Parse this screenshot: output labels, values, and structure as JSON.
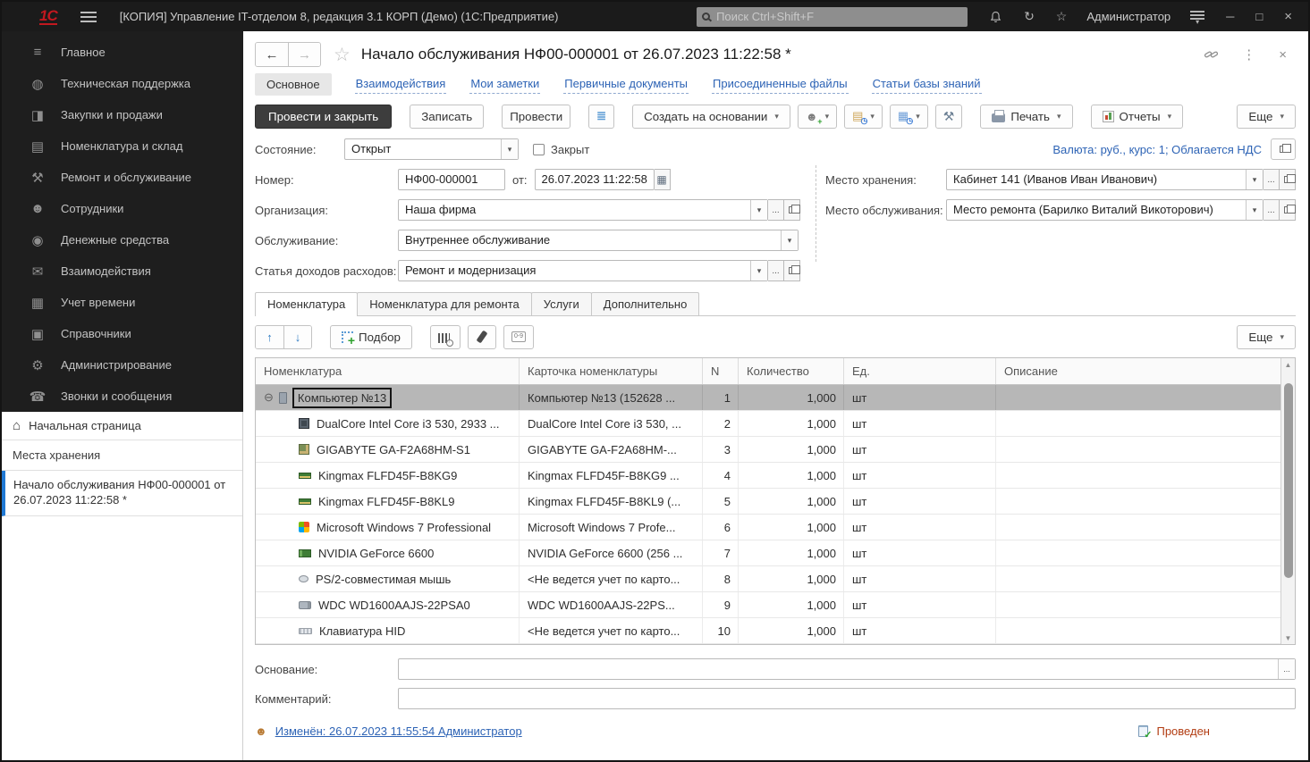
{
  "colors": {
    "accent_blue": "#2d63b5",
    "titlebar_bg": "#1b1b1b",
    "selected_row": "#b7b7b7",
    "posted": "#b23c12",
    "primary_button": "#3d3d3d",
    "logo_red": "#c2181f"
  },
  "icons": {
    "logo": "1С",
    "back": "←",
    "forward": "→",
    "favorite_star": "☆",
    "titlebar_star": "☆",
    "history": "↻",
    "kebab": "⋮",
    "close": "×",
    "minimize": "─",
    "maximize": "□",
    "dropdown": "▾",
    "ellipsis": "...",
    "home": "⌂",
    "expand_minus": "⊖",
    "move_up": "↑",
    "move_down": "↓",
    "person": "☻",
    "check": "✓",
    "bluelist": "≣",
    "people": "☻",
    "people_plus": "+",
    "doc": "▤",
    "list": "▦",
    "subclock": "◷",
    "tools": "⚒",
    "calendar": "▦",
    "numpad": "0-9",
    "pick_plus": "+",
    "scroll_up": "▲",
    "scroll_down": "▼"
  },
  "titlebar": {
    "app_title": "[КОПИЯ] Управление IT-отделом 8, редакция 3.1 КОРП (Демо)  (1С:Предприятие)",
    "search_placeholder": "Поиск Ctrl+Shift+F",
    "user": "Администратор"
  },
  "sidebar": {
    "items": [
      {
        "icon": "main-sections-icon",
        "glyph": "≡",
        "label": "Главное"
      },
      {
        "icon": "tech-support-icon",
        "glyph": "◍",
        "label": "Техническая поддержка"
      },
      {
        "icon": "purchases-sales-icon",
        "glyph": "◨",
        "label": "Закупки и продажи"
      },
      {
        "icon": "nomenclature-warehouse-icon",
        "glyph": "▤",
        "label": "Номенклатура и склад"
      },
      {
        "icon": "repair-service-icon",
        "glyph": "⚒",
        "label": "Ремонт и обслуживание"
      },
      {
        "icon": "employees-icon",
        "glyph": "☻",
        "label": "Сотрудники"
      },
      {
        "icon": "money-icon",
        "glyph": "◉",
        "label": "Денежные средства"
      },
      {
        "icon": "interactions-icon",
        "glyph": "✉",
        "label": "Взаимодействия"
      },
      {
        "icon": "time-tracking-icon",
        "glyph": "▦",
        "label": "Учет времени"
      },
      {
        "icon": "catalogs-icon",
        "glyph": "▣",
        "label": "Справочники"
      },
      {
        "icon": "administration-icon",
        "glyph": "⚙",
        "label": "Администрирование"
      },
      {
        "icon": "calls-messages-icon",
        "glyph": "☎",
        "label": "Звонки и сообщения"
      }
    ],
    "home_label": "Начальная страница",
    "pinned_label": "Места хранения",
    "open_doc": "Начало обслуживания НФ00-000001 от 26.07.2023 11:22:58 *"
  },
  "doc": {
    "title": "Начало обслуживания НФ00-000001 от 26.07.2023 11:22:58 *",
    "nav_tabs": [
      {
        "label": "Основное",
        "cls": "active"
      },
      {
        "label": "Взаимодействия",
        "cls": ""
      },
      {
        "label": "Мои заметки",
        "cls": ""
      },
      {
        "label": "Первичные документы",
        "cls": ""
      },
      {
        "label": "Присоединенные файлы",
        "cls": ""
      },
      {
        "label": "Статьи базы знаний",
        "cls": ""
      }
    ],
    "toolbar": {
      "post_and_close": "Провести и закрыть",
      "write": "Записать",
      "post": "Провести",
      "create_on_basis": "Создать на основании",
      "print": "Печать",
      "reports": "Отчеты",
      "more": "Еще"
    },
    "fields": {
      "state_label": "Состояние:",
      "state_value": "Открыт",
      "closed_label": "Закрыт",
      "number_label": "Номер:",
      "number_value": "НФ00-000001",
      "date_prefix": "от:",
      "date_value": "26.07.2023 11:22:58",
      "org_label": "Организация:",
      "org_value": "Наша фирма",
      "service_label": "Обслуживание:",
      "service_value": "Внутреннее обслуживание",
      "income_label": "Статья доходов расходов:",
      "income_value": "Ремонт и модернизация",
      "currency_info": "Валюта: руб., курс: 1; Облагается НДС",
      "storage_label": "Место хранения:",
      "storage_value": "Кабинет 141 (Иванов Иван Иванович)",
      "serviceplace_label": "Место обслуживания:",
      "serviceplace_value": "Место ремонта (Барилко Виталий Викоторович)",
      "basis_label": "Основание:",
      "basis_value": "",
      "comment_label": "Комментарий:",
      "comment_value": ""
    },
    "table_tabs": [
      {
        "label": "Номенклатура",
        "cls": "active"
      },
      {
        "label": "Номенклатура для ремонта",
        "cls": ""
      },
      {
        "label": "Услуги",
        "cls": ""
      },
      {
        "label": "Дополнительно",
        "cls": ""
      }
    ],
    "table_toolbar": {
      "pick": "Подбор",
      "more": "Еще"
    },
    "table": {
      "columns": [
        {
          "label": "Номенклатура",
          "cls": "c0"
        },
        {
          "label": "Карточка номенклатуры",
          "cls": "c1"
        },
        {
          "label": "N",
          "cls": "c2"
        },
        {
          "label": "Количество",
          "cls": "c3"
        },
        {
          "label": "Ед.",
          "cls": "c4"
        },
        {
          "label": "Описание",
          "cls": "c5"
        }
      ],
      "rows": [
        {
          "icon": "computer-icon",
          "icon_cls": "ic-computer",
          "row_cls": "selected",
          "name_cls": "focused",
          "expand": "⊖",
          "name": "Компьютер №13",
          "card": "Компьютер №13 (152628 ...",
          "n": "1",
          "qty": "1,000",
          "unit": "шт",
          "desc": ""
        },
        {
          "icon": "cpu-icon",
          "icon_cls": "ic-cpu",
          "row_cls": "child",
          "name_cls": "",
          "expand": "",
          "name": "DualCore Intel Core i3 530, 2933 ...",
          "card": "DualCore Intel Core i3 530, ...",
          "n": "2",
          "qty": "1,000",
          "unit": "шт",
          "desc": ""
        },
        {
          "icon": "motherboard-icon",
          "icon_cls": "ic-mobo",
          "row_cls": "child",
          "name_cls": "",
          "expand": "",
          "name": "GIGABYTE GA-F2A68HM-S1",
          "card": "GIGABYTE GA-F2A68HM-...",
          "n": "3",
          "qty": "1,000",
          "unit": "шт",
          "desc": ""
        },
        {
          "icon": "ram-icon",
          "icon_cls": "ic-ram",
          "row_cls": "child",
          "name_cls": "",
          "expand": "",
          "name": "Kingmax FLFD45F-B8KG9",
          "card": "Kingmax FLFD45F-B8KG9 ...",
          "n": "4",
          "qty": "1,000",
          "unit": "шт",
          "desc": ""
        },
        {
          "icon": "ram-icon",
          "icon_cls": "ic-ram",
          "row_cls": "child",
          "name_cls": "",
          "expand": "",
          "name": "Kingmax FLFD45F-B8KL9",
          "card": "Kingmax FLFD45F-B8KL9 (...",
          "n": "5",
          "qty": "1,000",
          "unit": "шт",
          "desc": ""
        },
        {
          "icon": "windows-icon",
          "icon_cls": "ic-windows",
          "row_cls": "child",
          "name_cls": "",
          "expand": "",
          "name": "Microsoft Windows 7 Professional",
          "card": "Microsoft Windows 7 Profe...",
          "n": "6",
          "qty": "1,000",
          "unit": "шт",
          "desc": ""
        },
        {
          "icon": "gpu-icon",
          "icon_cls": "ic-gpu",
          "row_cls": "child",
          "name_cls": "",
          "expand": "",
          "name": "NVIDIA GeForce 6600",
          "card": "NVIDIA GeForce 6600 (256 ...",
          "n": "7",
          "qty": "1,000",
          "unit": "шт",
          "desc": ""
        },
        {
          "icon": "mouse-icon",
          "icon_cls": "ic-mouse",
          "row_cls": "child",
          "name_cls": "",
          "expand": "",
          "name": "PS/2-совместимая мышь",
          "card": "<Не ведется учет по карто...",
          "n": "8",
          "qty": "1,000",
          "unit": "шт",
          "desc": ""
        },
        {
          "icon": "hdd-icon",
          "icon_cls": "ic-hdd",
          "row_cls": "child",
          "name_cls": "",
          "expand": "",
          "name": "WDC WD1600AAJS-22PSA0",
          "card": "WDC WD1600AAJS-22PS...",
          "n": "9",
          "qty": "1,000",
          "unit": "шт",
          "desc": ""
        },
        {
          "icon": "keyboard-icon",
          "icon_cls": "ic-keyboard",
          "row_cls": "child",
          "name_cls": "",
          "expand": "",
          "name": "Клавиатура HID",
          "card": "<Не ведется учет по карто...",
          "n": "10",
          "qty": "1,000",
          "unit": "шт",
          "desc": ""
        }
      ]
    },
    "footer": {
      "modified_link": "Изменён: 26.07.2023 11:55:54 Администратор",
      "posted_status": "Проведен"
    }
  }
}
